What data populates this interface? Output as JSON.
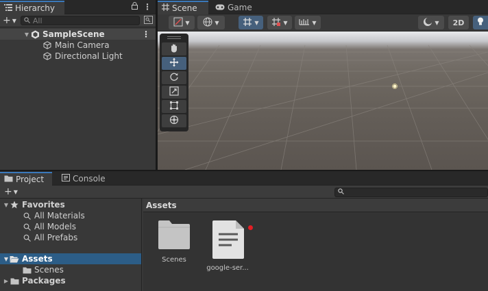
{
  "hierarchy": {
    "tab_label": "Hierarchy",
    "search_placeholder": "All",
    "scene_name": "SampleScene",
    "objects": [
      "Main Camera",
      "Directional Light"
    ]
  },
  "scene_view": {
    "tabs": [
      {
        "label": "Scene",
        "icon": "grid-icon",
        "active": true
      },
      {
        "label": "Game",
        "icon": "gamepad-icon",
        "active": false
      }
    ],
    "toolbar": {
      "toggle_2d_label": "2D"
    },
    "tools": [
      "hand-tool",
      "move-tool",
      "rotate-tool",
      "scale-tool",
      "rect-tool",
      "transform-tool"
    ],
    "selected_tool": "move-tool"
  },
  "project": {
    "tabs": [
      {
        "label": "Project",
        "icon": "folder-icon",
        "active": true
      },
      {
        "label": "Console",
        "icon": "console-icon",
        "active": false
      }
    ],
    "favorites_label": "Favorites",
    "favorites": [
      "All Materials",
      "All Models",
      "All Prefabs"
    ],
    "assets_label": "Assets",
    "asset_children": [
      "Scenes"
    ],
    "packages_label": "Packages",
    "breadcrumb": "Assets",
    "items": [
      {
        "label": "Scenes",
        "type": "folder"
      },
      {
        "label": "google-ser...",
        "type": "file"
      }
    ]
  },
  "colors": {
    "accent": "#3a79bb",
    "selection": "#2c5d87",
    "notification_dot": "#e31e24"
  }
}
